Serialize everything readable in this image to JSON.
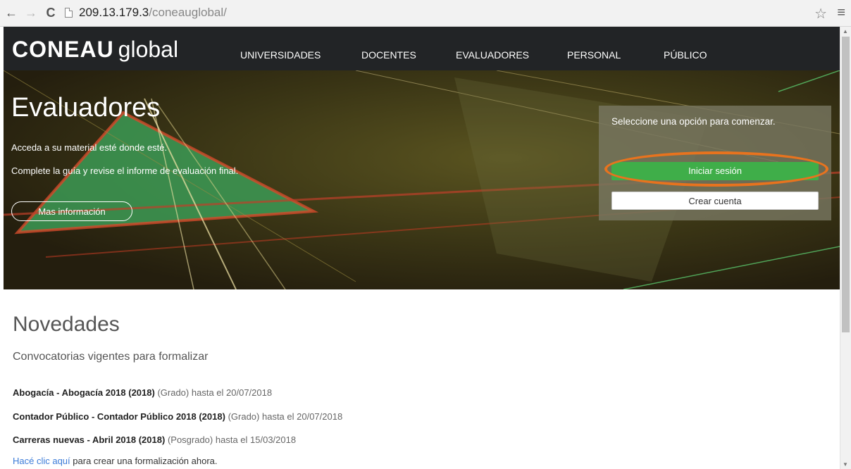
{
  "browser": {
    "url_host": "209.13.179.3",
    "url_path": "/coneauglobal/",
    "back_glyph": "←",
    "forward_glyph": "→",
    "reload_glyph": "C",
    "star_glyph": "☆",
    "menu_glyph": "≡",
    "scroll_up_glyph": "▲",
    "scroll_down_glyph": "▼"
  },
  "site": {
    "logo_strong": "CONEAU",
    "logo_light": "global",
    "nav": [
      "UNIVERSIDADES",
      "DOCENTES",
      "EVALUADORES",
      "PERSONAL",
      "PÚBLICO"
    ]
  },
  "hero": {
    "title": "Evaluadores",
    "line1": "Acceda a su material esté donde esté.",
    "line2": "Complete la guía y revise el informe de evaluación final.",
    "more_button": "Mas información",
    "panel_prompt": "Seleccione una opción para comenzar.",
    "login_button": "Iniciar sesión",
    "create_button": "Crear cuenta",
    "colors": {
      "login_green": "#3fae49",
      "highlight": "#e8731e"
    }
  },
  "news": {
    "title": "Novedades",
    "subtitle": "Convocatorias vigentes para formalizar",
    "items": [
      {
        "name": "Abogacía - Abogacía 2018 (2018)",
        "level": "(Grado)",
        "deadline": "hasta el 20/07/2018"
      },
      {
        "name": "Contador Público - Contador Público 2018 (2018)",
        "level": "(Grado)",
        "deadline": "hasta el 20/07/2018"
      },
      {
        "name": "Carreras nuevas - Abril 2018 (2018)",
        "level": "(Posgrado)",
        "deadline": "hasta el 15/03/2018"
      }
    ],
    "cta_link": "Hacé clic aquí",
    "cta_text": "para crear una formalización ahora."
  }
}
